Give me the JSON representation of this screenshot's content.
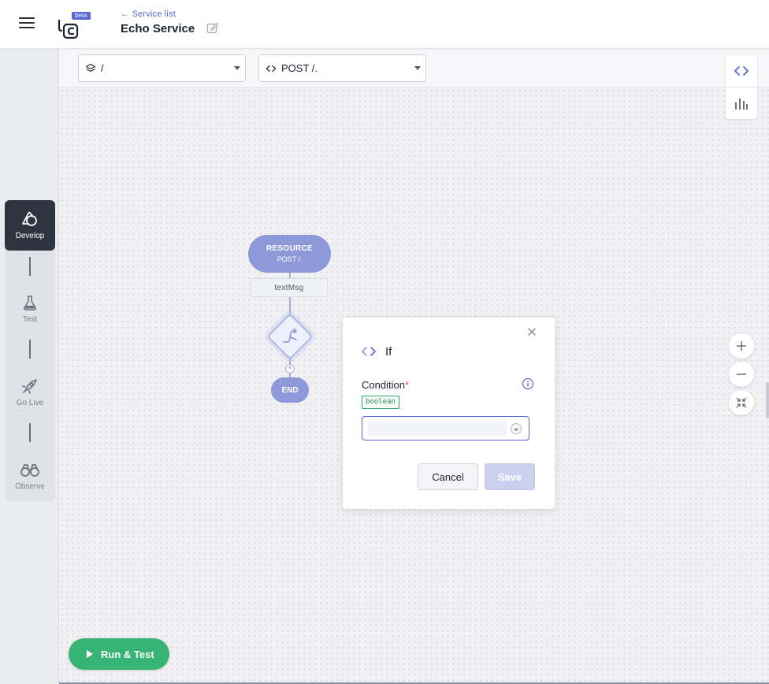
{
  "header": {
    "back_link": "← Service list",
    "title": "Echo Service",
    "beta_badge": "beta"
  },
  "nav": {
    "steps": [
      {
        "label": "Develop",
        "icon": "develop-icon",
        "active": true
      },
      {
        "label": "Test",
        "icon": "flask-icon",
        "active": false
      },
      {
        "label": "Go Live",
        "icon": "rocket-icon",
        "active": false
      },
      {
        "label": "Observe",
        "icon": "binoculars-icon",
        "active": false
      }
    ]
  },
  "toolbar": {
    "path_select": "/",
    "resource_select": "POST /."
  },
  "diagram": {
    "resource_title": "RESOURCE",
    "resource_subtitle": "POST /.",
    "param_label": "textMsg",
    "end_label": "END"
  },
  "form": {
    "title": "If",
    "condition_label": "Condition",
    "required_mark": "*",
    "type_tag": "boolean",
    "condition_value": "",
    "cancel_label": "Cancel",
    "save_label": "Save"
  },
  "run_button": {
    "label": "Run & Test"
  },
  "colors": {
    "accent": "#5567d5",
    "node": "#8e99d9",
    "run_green": "#36b475",
    "active_nav": "#2f3440",
    "required": "#e24c4c",
    "type_tag_green": "#2fa96a"
  }
}
